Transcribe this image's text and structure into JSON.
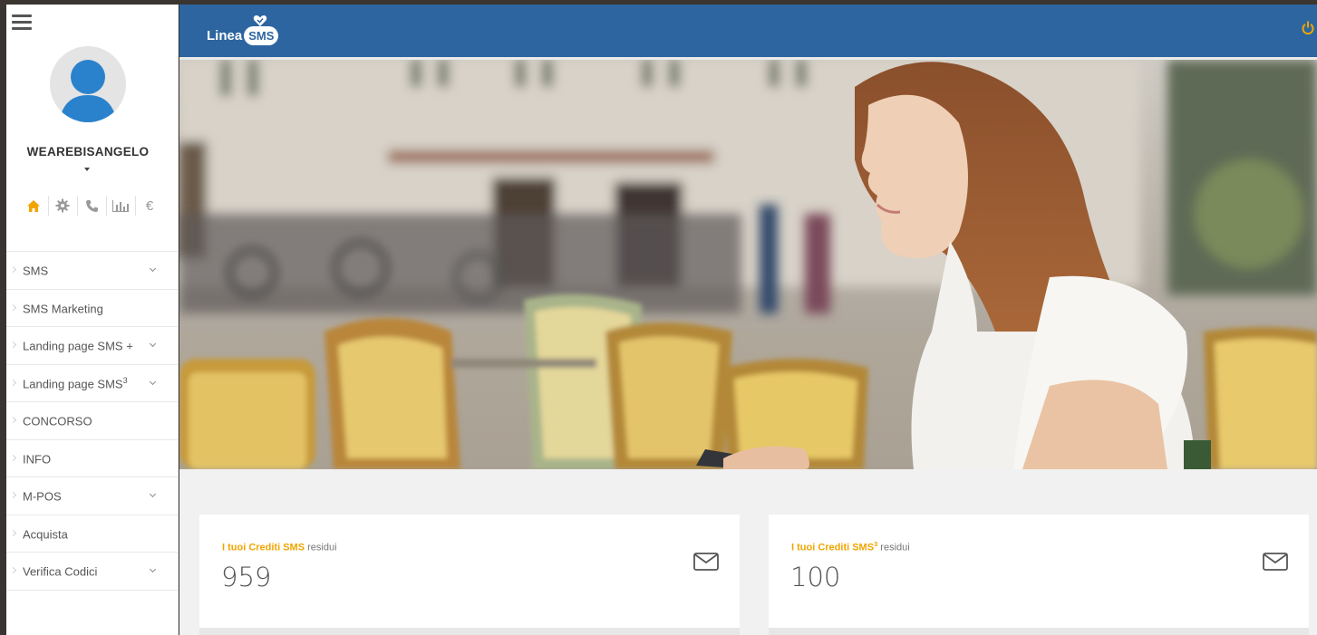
{
  "sidebar": {
    "username": "WEAREBISANGELO",
    "quick_icons": [
      "home-icon",
      "gear-icon",
      "phone-icon",
      "chart-icon",
      "euro-icon"
    ],
    "euro_symbol": "€",
    "items": [
      {
        "label": "SMS",
        "sup": "",
        "has_submenu": true
      },
      {
        "label": "SMS Marketing",
        "sup": "",
        "has_submenu": false
      },
      {
        "label": "Landing page SMS +",
        "sup": "",
        "has_submenu": true
      },
      {
        "label": "Landing page SMS",
        "sup": "3",
        "has_submenu": true
      },
      {
        "label": "CONCORSO",
        "sup": "",
        "has_submenu": false
      },
      {
        "label": "INFO",
        "sup": "",
        "has_submenu": false
      },
      {
        "label": "M-POS",
        "sup": "",
        "has_submenu": true
      },
      {
        "label": "Acquista",
        "sup": "",
        "has_submenu": false
      },
      {
        "label": "Verifica Codici",
        "sup": "",
        "has_submenu": true
      }
    ]
  },
  "header": {
    "logo_text": "Linea",
    "logo_badge": "SMS",
    "brand_color": "#2c65a0",
    "power_color": "#f0a500"
  },
  "cards": [
    {
      "highlight": "I tuoi Crediti SMS",
      "sup": "",
      "suffix": " residui",
      "value": "959"
    },
    {
      "highlight": "I tuoi Crediti SMS",
      "sup": "3",
      "suffix": " residui",
      "value": "100"
    }
  ],
  "colors": {
    "accent": "#f0a500",
    "sidebar_text": "#555555"
  }
}
